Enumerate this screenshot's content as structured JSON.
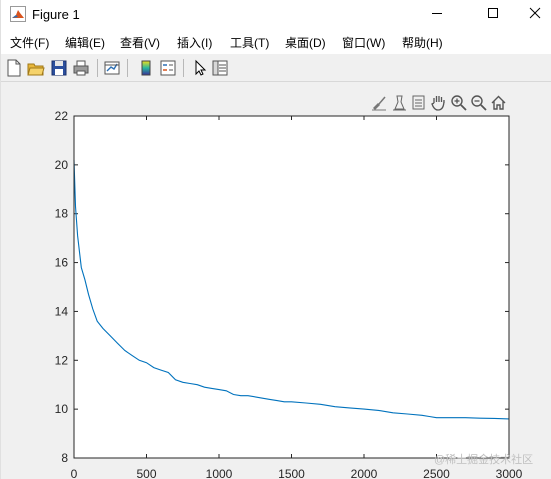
{
  "window": {
    "title": "Figure 1"
  },
  "menu": [
    "文件(F)",
    "编辑(E)",
    "查看(V)",
    "插入(I)",
    "工具(T)",
    "桌面(D)",
    "窗口(W)",
    "帮助(H)"
  ],
  "toolbar_icons": [
    "new-figure-icon",
    "open-file-icon",
    "save-icon",
    "print-icon",
    "link-plot-icon",
    "colorbar-icon",
    "legend-icon",
    "pointer-icon",
    "property-editor-icon"
  ],
  "axes_toolbar_icons": [
    "brush-icon",
    "data-tips-icon",
    "export-icon",
    "pan-icon",
    "zoom-in-icon",
    "zoom-out-icon",
    "home-icon"
  ],
  "watermark": "@稀土掘金技术社区",
  "colors": {
    "line": "#0072bd",
    "axes_bg": "#ffffff",
    "figure_bg": "#f0f0f0"
  },
  "chart_data": {
    "type": "line",
    "title": "",
    "xlabel": "",
    "ylabel": "",
    "xlim": [
      0,
      3000
    ],
    "ylim": [
      8,
      22
    ],
    "xticks": [
      0,
      500,
      1000,
      1500,
      2000,
      2500,
      3000
    ],
    "yticks": [
      8,
      10,
      12,
      14,
      16,
      18,
      20,
      22
    ],
    "grid": false,
    "series": [
      {
        "x": [
          0,
          10,
          25,
          50,
          75,
          100,
          130,
          160,
          200,
          250,
          300,
          350,
          400,
          450,
          500,
          550,
          600,
          650,
          700,
          750,
          800,
          850,
          900,
          950,
          1000,
          1050,
          1100,
          1150,
          1200,
          1250,
          1300,
          1350,
          1400,
          1450,
          1500,
          1600,
          1700,
          1800,
          1900,
          2000,
          2100,
          2200,
          2300,
          2400,
          2450,
          2500,
          2600,
          2700,
          2800,
          2900,
          3000
        ],
        "y": [
          20.2,
          18.3,
          17.1,
          15.8,
          15.3,
          14.7,
          14.1,
          13.6,
          13.3,
          13.0,
          12.7,
          12.4,
          12.2,
          12.0,
          11.9,
          11.7,
          11.6,
          11.5,
          11.2,
          11.1,
          11.05,
          11.0,
          10.9,
          10.85,
          10.8,
          10.75,
          10.6,
          10.55,
          10.55,
          10.5,
          10.45,
          10.4,
          10.35,
          10.3,
          10.3,
          10.25,
          10.2,
          10.1,
          10.05,
          10.0,
          9.95,
          9.85,
          9.8,
          9.75,
          9.7,
          9.65,
          9.65,
          9.65,
          9.63,
          9.62,
          9.6
        ]
      }
    ]
  }
}
